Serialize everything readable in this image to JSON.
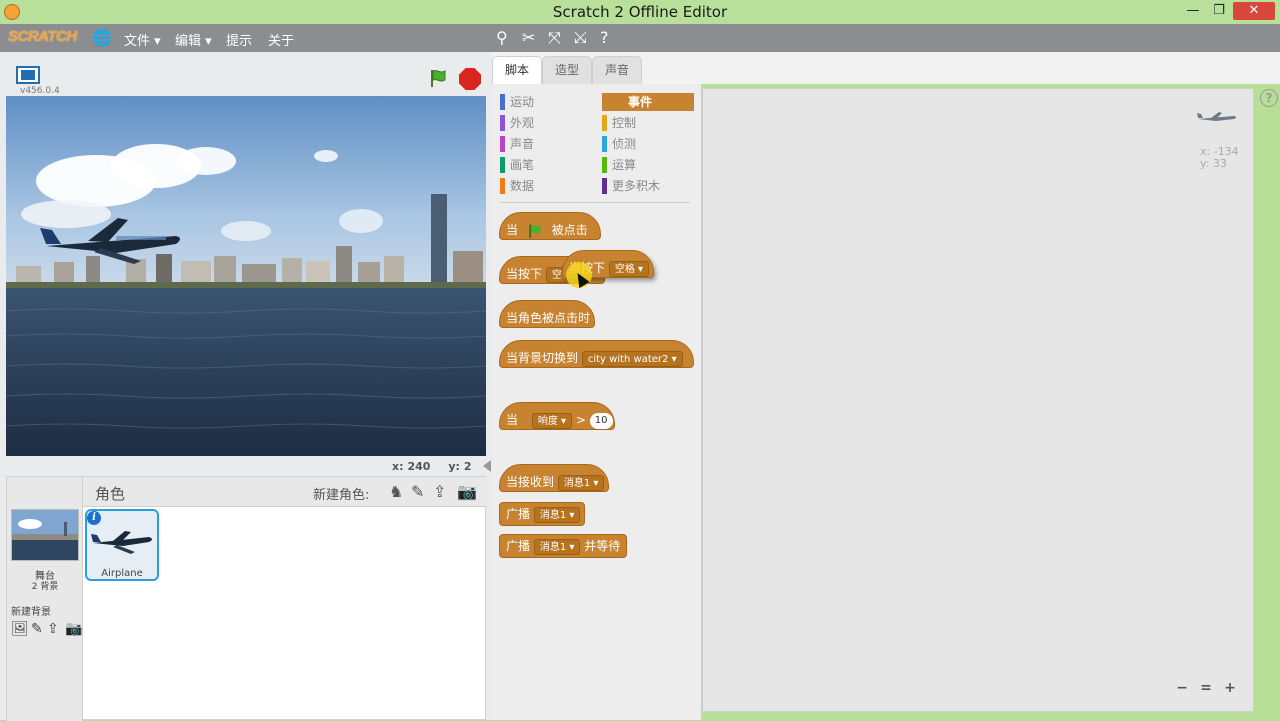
{
  "window": {
    "title": "Scratch 2 Offline Editor",
    "minimize": "—",
    "maximize": "❐",
    "close": "✕"
  },
  "menubar": {
    "logo": "SCRATCH",
    "items": [
      {
        "label": "文件 ▾"
      },
      {
        "label": "编辑 ▾"
      },
      {
        "label": "提示"
      },
      {
        "label": "关于"
      }
    ],
    "tools": [
      "duplicate-icon",
      "delete-icon",
      "grow-icon",
      "shrink-icon",
      "help-icon"
    ]
  },
  "stage": {
    "version": "v456.0.4",
    "coords": {
      "x_label": "x:",
      "x": "240",
      "y_label": "y:",
      "y": "2"
    }
  },
  "sprites": {
    "header_label": "角色",
    "new_sprite_label": "新建角色:",
    "stage_name": "舞台",
    "bg_count": "2 背景",
    "new_bg_label": "新建背景",
    "sprite_list": [
      {
        "name": "Airplane"
      }
    ]
  },
  "tabs": [
    {
      "label": "脚本",
      "active": true
    },
    {
      "label": "造型"
    },
    {
      "label": "声音"
    }
  ],
  "categories": [
    {
      "label": "运动",
      "color": "#4a6cd4"
    },
    {
      "label": "外观",
      "color": "#8a55d7"
    },
    {
      "label": "声音",
      "color": "#bb42c3"
    },
    {
      "label": "画笔",
      "color": "#0e9a6c"
    },
    {
      "label": "数据",
      "color": "#ee7d16"
    },
    {
      "label": "事件",
      "color": "#c88330",
      "selected": true
    },
    {
      "label": "控制",
      "color": "#e1a91a"
    },
    {
      "label": "侦测",
      "color": "#2ca5e2"
    },
    {
      "label": "运算",
      "color": "#5cb712"
    },
    {
      "label": "更多积木",
      "color": "#632d99"
    }
  ],
  "blocks": {
    "flag_hat": {
      "prefix": "当",
      "suffix": "被点击"
    },
    "key_hat": {
      "prefix": "当按下",
      "key": "空格"
    },
    "key_hat_drag": {
      "prefix": "当按下",
      "key": "空格"
    },
    "sprite_click": {
      "label": "当角色被点击时"
    },
    "backdrop_switch": {
      "prefix": "当背景切换到",
      "value": "city with water2"
    },
    "sensor_hat": {
      "prefix": "当",
      "sensor": "响度",
      "op": ">",
      "value": "10"
    },
    "receive_hat": {
      "prefix": "当接收到",
      "message": "消息1"
    },
    "broadcast": {
      "prefix": "广播",
      "message": "消息1"
    },
    "broadcast_wait": {
      "prefix": "广播",
      "message": "消息1",
      "suffix": "并等待"
    }
  },
  "script_area": {
    "x_label": "x:",
    "x": "-134",
    "y_label": "y:",
    "y": "33"
  },
  "zoom": {
    "out": "−",
    "reset": "=",
    "in": "+"
  }
}
